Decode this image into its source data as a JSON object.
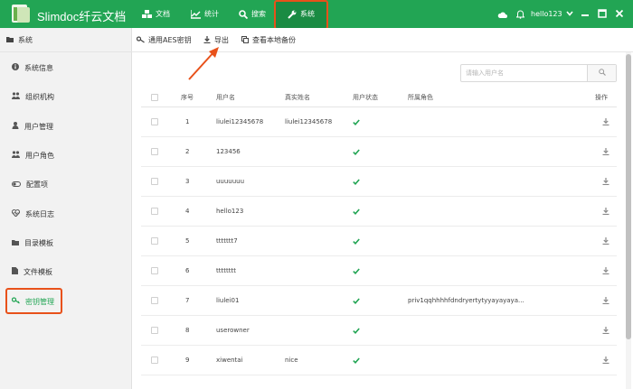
{
  "app": {
    "title": "Slimdoc纤云文档"
  },
  "nav": {
    "items": [
      {
        "label": "文档",
        "icon": "cubes-icon"
      },
      {
        "label": "统计",
        "icon": "line-chart-icon"
      },
      {
        "label": "搜索",
        "icon": "search-icon"
      },
      {
        "label": "系统",
        "icon": "wrench-icon",
        "active": true
      }
    ]
  },
  "user": {
    "name": "hello123"
  },
  "sidebar": {
    "header": "系统",
    "items": [
      {
        "label": "系统信息",
        "icon": "info-circle-icon"
      },
      {
        "label": "组织机构",
        "icon": "users-icon"
      },
      {
        "label": "用户管理",
        "icon": "user-icon"
      },
      {
        "label": "用户角色",
        "icon": "users-icon"
      },
      {
        "label": "配置项",
        "icon": "toggle-icon"
      },
      {
        "label": "系统日志",
        "icon": "heartbeat-icon"
      },
      {
        "label": "目录模板",
        "icon": "folder-icon"
      },
      {
        "label": "文件模板",
        "icon": "file-icon"
      },
      {
        "label": "密钥管理",
        "icon": "key-icon",
        "active": true
      }
    ]
  },
  "toolbar": {
    "aes_label": "通用AES密钥",
    "export_label": "导出",
    "backup_label": "查看本地备份"
  },
  "search": {
    "placeholder": "请输入用户名"
  },
  "table": {
    "headers": {
      "index": "序号",
      "username": "用户名",
      "realname": "真实姓名",
      "status": "用户状态",
      "roles": "所属角色",
      "actions": "操作"
    },
    "rows": [
      {
        "index": "1",
        "username": "liulei12345678",
        "realname": "liulei12345678",
        "roles": ""
      },
      {
        "index": "2",
        "username": "123456",
        "realname": "",
        "roles": ""
      },
      {
        "index": "3",
        "username": "uuuuuuu",
        "realname": "",
        "roles": ""
      },
      {
        "index": "4",
        "username": "hello123",
        "realname": "",
        "roles": ""
      },
      {
        "index": "5",
        "username": "ttttttt7",
        "realname": "",
        "roles": ""
      },
      {
        "index": "6",
        "username": "tttttttt",
        "realname": "",
        "roles": ""
      },
      {
        "index": "7",
        "username": "liulei01",
        "realname": "",
        "roles": "priv1qqhhhhfdndryertytyyayayaya..."
      },
      {
        "index": "8",
        "username": "userowner",
        "realname": "",
        "roles": ""
      },
      {
        "index": "9",
        "username": "xiwentai",
        "realname": "nice",
        "roles": ""
      }
    ]
  },
  "colors": {
    "primary": "#22a554",
    "nav_active": "#1a8b43",
    "annotation": "#e8511a"
  }
}
